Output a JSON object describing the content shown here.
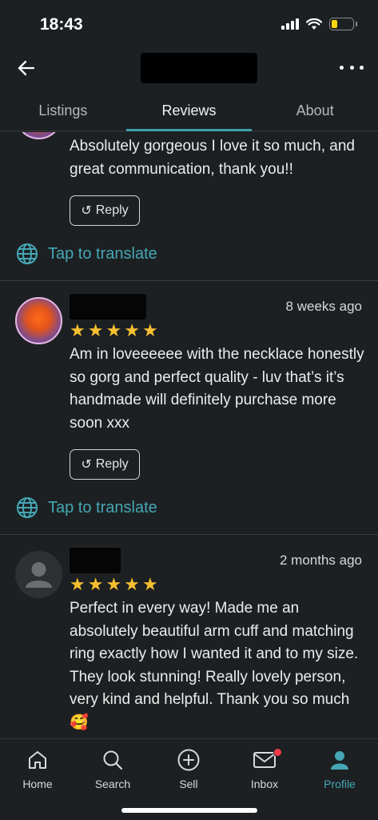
{
  "status": {
    "time": "18:43"
  },
  "tabs": [
    {
      "label": "Listings"
    },
    {
      "label": "Reviews"
    },
    {
      "label": "About"
    }
  ],
  "reviews": [
    {
      "text": "Absolutely gorgeous I love it so much, and great communication, thank you!!",
      "reply_label": "Reply",
      "translate_label": "Tap to translate"
    },
    {
      "date": "8 weeks ago",
      "rating": 5,
      "text": "Am in loveeeeee with the necklace honestly so gorg and perfect quality - luv that’s it’s handmade will definitely purchase more soon xxx",
      "reply_label": "Reply",
      "translate_label": "Tap to translate"
    },
    {
      "date": "2 months ago",
      "rating": 5,
      "text": "Perfect in every way! Made me an absolutely beautiful arm cuff and matching ring exactly how I wanted it and to my size. They look stunning! Really lovely person, very kind and helpful. Thank you so much 🥰"
    }
  ],
  "bottom_nav": [
    {
      "label": "Home",
      "icon": "home-icon"
    },
    {
      "label": "Search",
      "icon": "search-icon"
    },
    {
      "label": "Sell",
      "icon": "plus-circle-icon"
    },
    {
      "label": "Inbox",
      "icon": "mail-icon",
      "badge": true
    },
    {
      "label": "Profile",
      "icon": "profile-icon",
      "active": true
    }
  ],
  "colors": {
    "accent": "#45a7b5",
    "star": "#f6bf2f",
    "background": "#1d2022",
    "badge": "#ef3b4b"
  }
}
